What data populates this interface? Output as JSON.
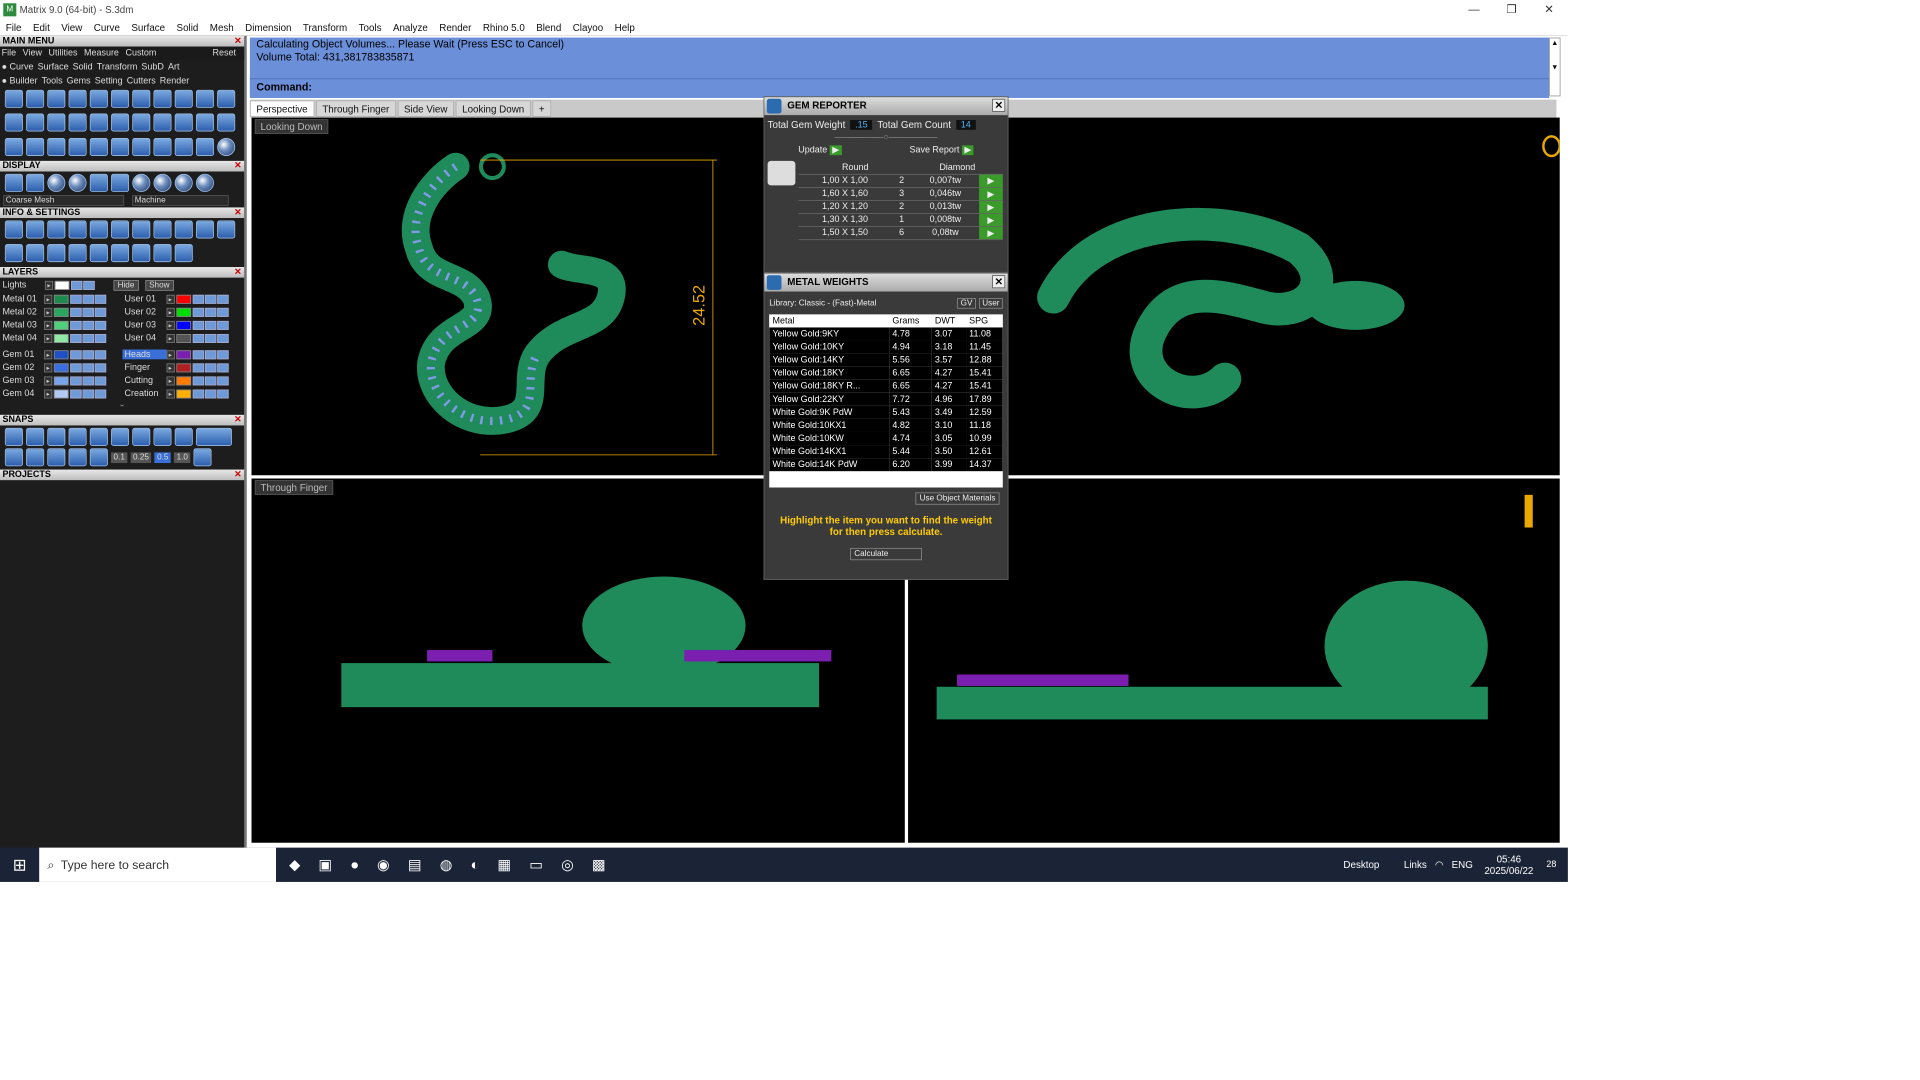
{
  "window": {
    "title": "Matrix 9.0 (64-bit) - S.3dm",
    "logo": "M"
  },
  "menubar": [
    "File",
    "Edit",
    "View",
    "Curve",
    "Surface",
    "Solid",
    "Mesh",
    "Dimension",
    "Transform",
    "Tools",
    "Analyze",
    "Render",
    "Rhino 5.0",
    "Blend",
    "Clayoo",
    "Help"
  ],
  "left": {
    "main_menu_title": "MAIN MENU",
    "submenu": [
      "File",
      "View",
      "Utilities",
      "Measure",
      "Custom"
    ],
    "reset": "Reset",
    "menu_row1": [
      "Curve",
      "Surface",
      "Solid",
      "Transform",
      "SubD",
      "Art"
    ],
    "menu_row2": [
      "Builder",
      "Tools",
      "Gems",
      "Setting",
      "Cutters",
      "Render"
    ],
    "display_title": "DISPLAY",
    "display_opt1": "Coarse Mesh",
    "display_opt2": "Machine",
    "info_title": "INFO & SETTINGS",
    "layers_title": "LAYERS",
    "lights": "Lights",
    "hide": "Hide",
    "show": "Show",
    "layers_left": [
      {
        "name": "Metal 01",
        "color": "#1e8a4e"
      },
      {
        "name": "Metal 02",
        "color": "#2aa55e"
      },
      {
        "name": "Metal 03",
        "color": "#4fcf7a"
      },
      {
        "name": "Metal 04",
        "color": "#8fe8a6"
      },
      {
        "name": "Gem 01",
        "color": "#1f4fc4"
      },
      {
        "name": "Gem 02",
        "color": "#3a6ee0"
      },
      {
        "name": "Gem 03",
        "color": "#78a4ec"
      },
      {
        "name": "Gem 04",
        "color": "#b2c9f3"
      }
    ],
    "layers_right": [
      {
        "name": "User 01",
        "color": "#ff0000"
      },
      {
        "name": "User 02",
        "color": "#00dd00"
      },
      {
        "name": "User 03",
        "color": "#0000ff"
      },
      {
        "name": "User 04",
        "color": "#555555"
      },
      {
        "name": "Heads",
        "color": "#7a1fb0"
      },
      {
        "name": "Finger",
        "color": "#b02020"
      },
      {
        "name": "Cutting",
        "color": "#ff7a00"
      },
      {
        "name": "Creation",
        "color": "#ffb000"
      }
    ],
    "snaps_title": "SNAPS",
    "snap_values": [
      "0.1",
      "0.25",
      "0.5",
      "1.0"
    ],
    "projects_title": "PROJECTS"
  },
  "command": {
    "line1": "Calculating Object Volumes... Please Wait (Press ESC to Cancel)",
    "line2": "Volume Total: 431,381783835871",
    "prompt": "Command:"
  },
  "tabs": [
    "Perspective",
    "Through Finger",
    "Side View",
    "Looking Down",
    "+"
  ],
  "viewports": {
    "top_left": "Looking Down",
    "bottom_left": "Through Finger",
    "dimension": "24.52"
  },
  "gem_reporter": {
    "title": "GEM REPORTER",
    "total_weight_label": "Total Gem Weight",
    "total_weight": ".15",
    "total_count_label": "Total Gem Count",
    "total_count": "14",
    "update": "Update",
    "save": "Save Report",
    "head_shape": "Round",
    "head_type": "Diamond",
    "rows": [
      {
        "size": "1,00 X 1,00",
        "qty": "2",
        "ct": "0,007tw"
      },
      {
        "size": "1,60 X 1,60",
        "qty": "3",
        "ct": "0,046tw"
      },
      {
        "size": "1,20 X 1,20",
        "qty": "2",
        "ct": "0,013tw"
      },
      {
        "size": "1,30 X 1,30",
        "qty": "1",
        "ct": "0,008tw"
      },
      {
        "size": "1,50 X 1,50",
        "qty": "6",
        "ct": "0,08tw"
      }
    ]
  },
  "metal_weights": {
    "title": "METAL WEIGHTS",
    "library": "Library: Classic - (Fast)-Metal",
    "gv": "GV",
    "user": "User",
    "headers": [
      "Metal",
      "Grams",
      "DWT",
      "SPG"
    ],
    "rows": [
      [
        "Yellow Gold:9KY",
        "4.78",
        "3.07",
        "11.08"
      ],
      [
        "Yellow Gold:10KY",
        "4.94",
        "3.18",
        "11.45"
      ],
      [
        "Yellow Gold:14KY",
        "5.56",
        "3.57",
        "12.88"
      ],
      [
        "Yellow Gold:18KY",
        "6.65",
        "4.27",
        "15.41"
      ],
      [
        "Yellow Gold:18KY R...",
        "6.65",
        "4.27",
        "15.41"
      ],
      [
        "Yellow Gold:22KY",
        "7.72",
        "4.96",
        "17.89"
      ],
      [
        "White Gold:9K PdW",
        "5.43",
        "3.49",
        "12.59"
      ],
      [
        "White Gold:10KX1",
        "4.82",
        "3.10",
        "11.18"
      ],
      [
        "White Gold:10KW",
        "4.74",
        "3.05",
        "10.99"
      ],
      [
        "White Gold:14KX1",
        "5.44",
        "3.50",
        "12.61"
      ],
      [
        "White Gold:14K PdW",
        "6.20",
        "3.99",
        "14.37"
      ]
    ],
    "use_object": "Use Object Materials",
    "hint": "Highlight the item you want to find the weight for then press calculate.",
    "calculate": "Calculate"
  },
  "taskbar": {
    "search": "Type here to search",
    "desktop": "Desktop",
    "links": "Links",
    "lang": "ENG",
    "time": "05:46",
    "date": "2025/06/22",
    "notif": "28"
  }
}
